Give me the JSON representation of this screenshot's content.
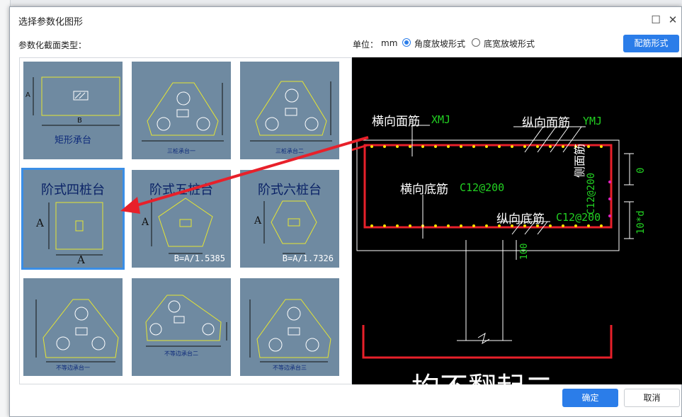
{
  "dialog": {
    "title": "选择参数化图形",
    "section_label": "参数化截面类型：",
    "unit_label": "单位：",
    "unit_value": "mm",
    "radio_angle": "角度放坡形式",
    "radio_width": "底宽放坡形式",
    "rebar_button": "配筋形式",
    "ok_button": "确定",
    "cancel_button": "取消"
  },
  "shapes": [
    {
      "caption": "矩形承台",
      "dim_a": "A",
      "dim_b": "B"
    },
    {
      "caption": "三桩承台一"
    },
    {
      "caption": "三桩承台二"
    },
    {
      "caption": "阶式四桩台",
      "dim_a": "A",
      "dim_b": "A"
    },
    {
      "caption": "阶式五桩台",
      "dim_a": "A",
      "formula": "B=A/1.5385"
    },
    {
      "caption": "阶式六桩台",
      "dim_a": "A",
      "formula": "B=A/1.7326"
    },
    {
      "caption": "不等边承台一"
    },
    {
      "caption": "不等边承台二"
    },
    {
      "caption": "不等边承台三"
    }
  ],
  "preview": {
    "h_top_label": "横向面筋",
    "h_top_code": "XMJ",
    "v_top_label": "纵向面筋",
    "v_top_code": "YMJ",
    "h_bottom_label": "横向底筋",
    "h_bottom_code": "C12@200",
    "v_bottom_label": "纵向底筋",
    "v_bottom_code": "C12@200",
    "side_label": "侧面筋",
    "side_code": "C12@200",
    "dim_0": "0",
    "dim_10d": "10*d",
    "dim_100": "100",
    "big_text": "均不翻起二"
  },
  "colors": {
    "accent": "#2b7de9",
    "tile_bg": "#6f8aa1",
    "rebar_red": "#e8202a",
    "label_green": "#22d022",
    "dot_yellow": "#ffe000"
  }
}
